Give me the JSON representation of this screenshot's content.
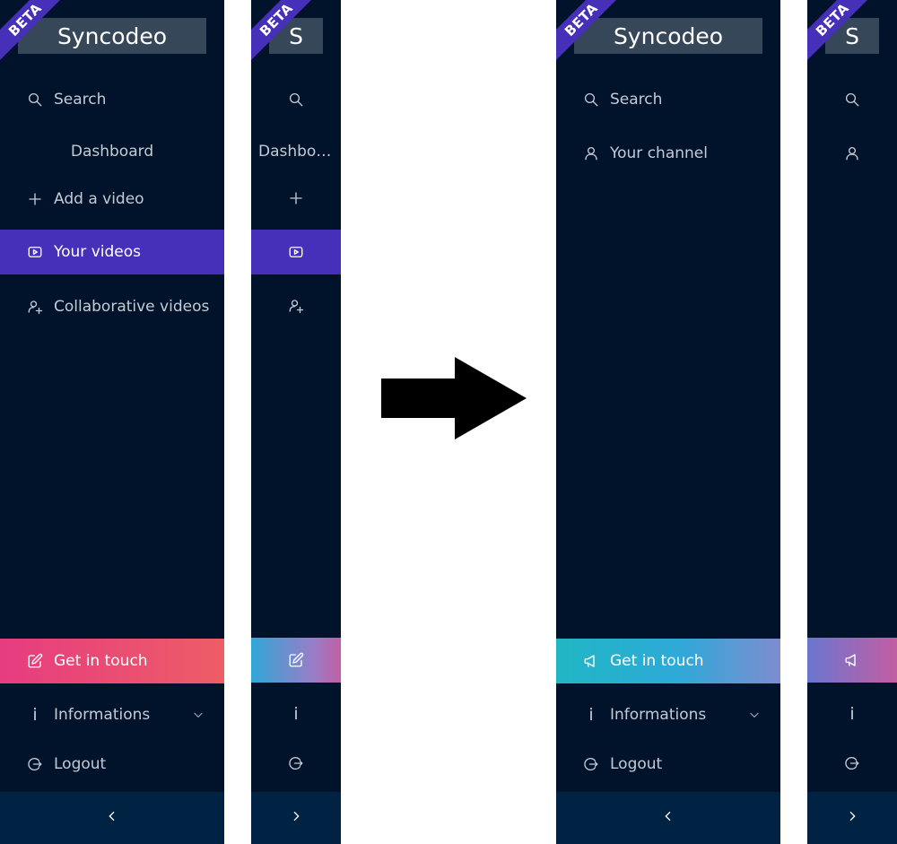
{
  "colors": {
    "sidebar_bg": "#00132b",
    "logo_bg": "#354758",
    "active_bg": "#4630b9",
    "beta_ribbon": "#4630b9",
    "footer_bg": "#002343",
    "cta_before": "#e63c80",
    "cta_after": "#20b7c5"
  },
  "before": {
    "expanded": {
      "beta": "BETA",
      "logo": "Syncodeo",
      "search": "Search",
      "dashboard": "Dashboard",
      "add_video": "Add a video",
      "your_videos": "Your videos",
      "collab_videos": "Collaborative videos",
      "get_in_touch": "Get in touch",
      "informations": "Informations",
      "logout": "Logout",
      "toggle_icon": "chevron-left-icon"
    },
    "collapsed": {
      "beta": "BETA",
      "logo": "S",
      "dashboard": "Dashboa...",
      "toggle_icon": "chevron-right-icon"
    }
  },
  "after": {
    "expanded": {
      "beta": "BETA",
      "logo": "Syncodeo",
      "search": "Search",
      "your_channel": "Your channel",
      "get_in_touch": "Get in touch",
      "informations": "Informations",
      "logout": "Logout",
      "toggle_icon": "chevron-left-icon"
    },
    "collapsed": {
      "beta": "BETA",
      "logo": "S",
      "toggle_icon": "chevron-right-icon"
    }
  },
  "transition_icon": "arrow-right-icon"
}
